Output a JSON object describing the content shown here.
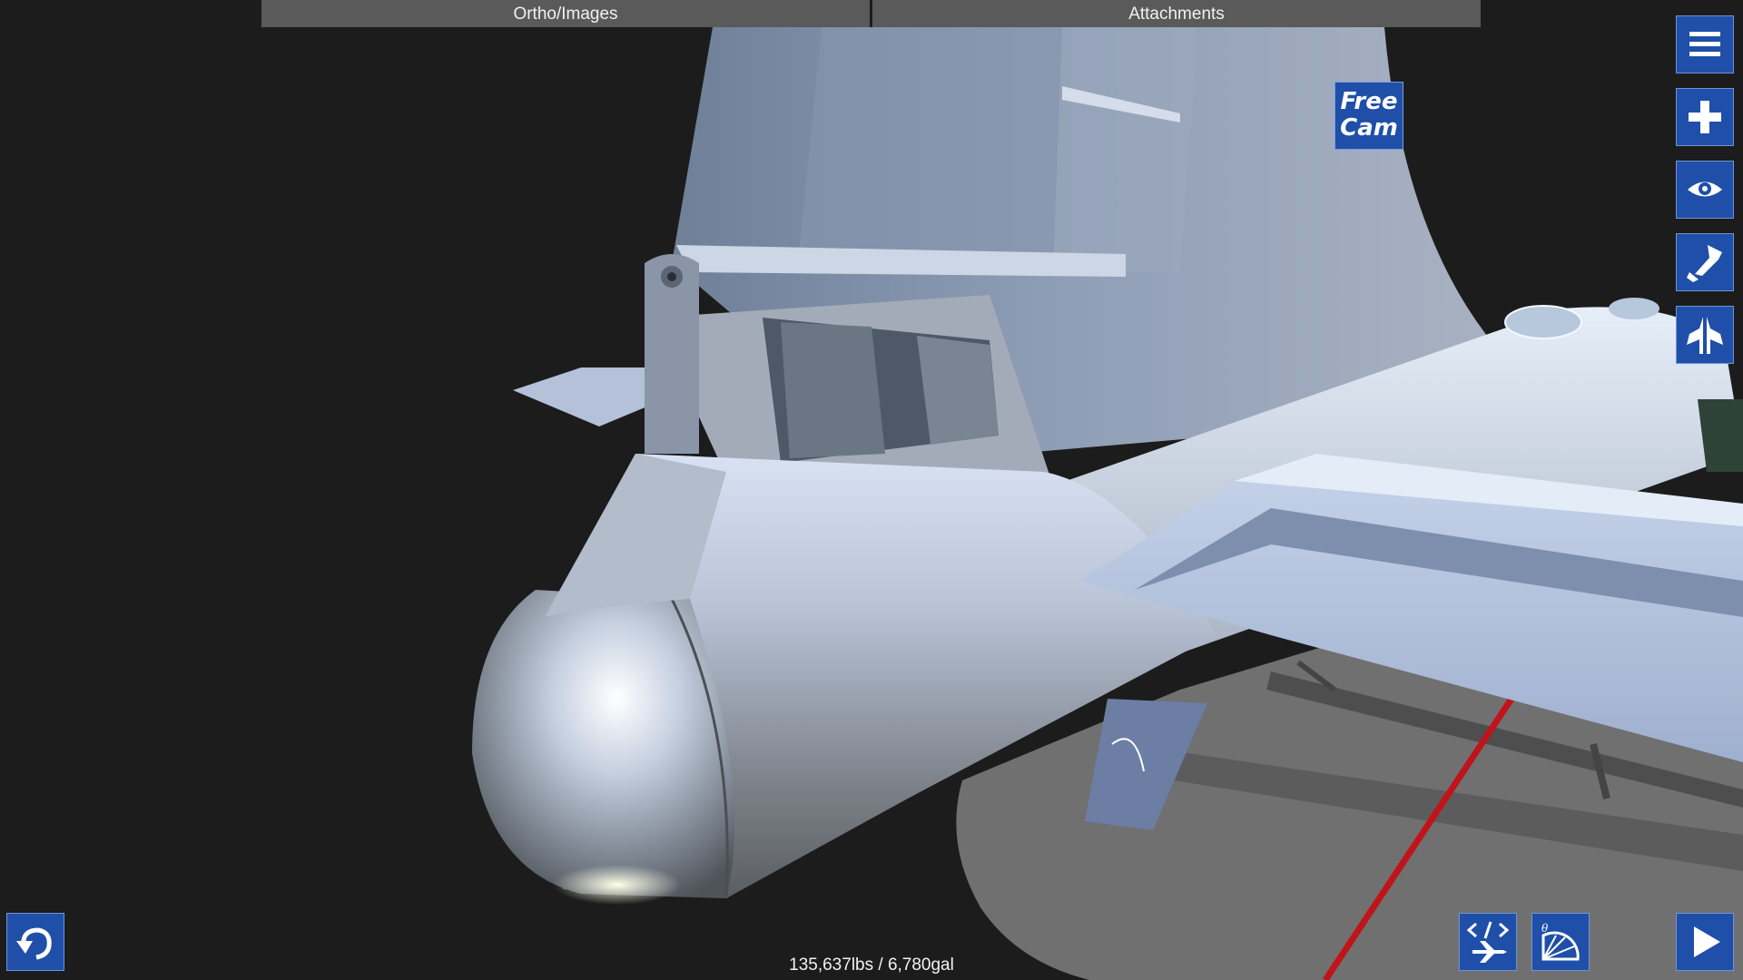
{
  "tabs": {
    "ortho_label": "Ortho/Images",
    "attachments_label": "Attachments"
  },
  "free_cam": {
    "line1": "Free",
    "line2": "Cam"
  },
  "stats": "135,637lbs / 6,780gal",
  "right_toolbar": [
    "menu-icon",
    "add-part-icon",
    "view-icon",
    "paint-icon",
    "symmetry-icon"
  ],
  "bottom_toolbar": [
    "undo-icon",
    "xml-edit-icon",
    "flight-stats-icon",
    "play-icon"
  ],
  "colors": {
    "button_blue": "#1f4fa8",
    "tab_gray": "#5a5a5a",
    "background": "#1c1c1c",
    "center_of_mass_line": "#c0141a"
  }
}
